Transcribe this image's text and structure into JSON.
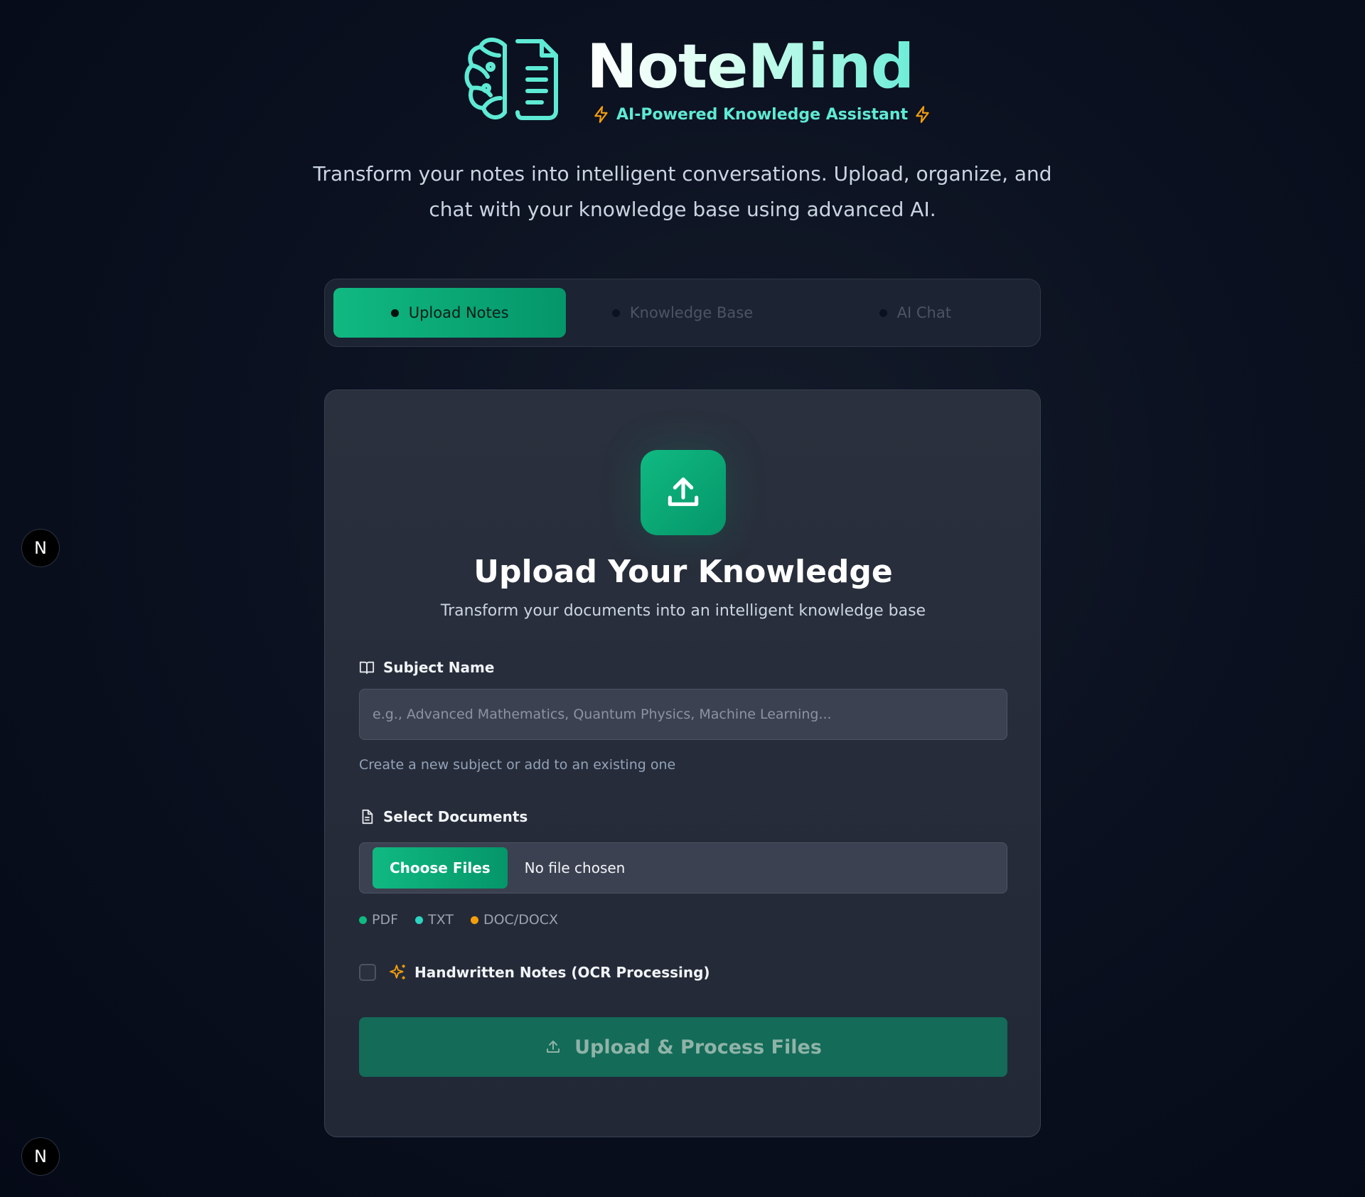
{
  "brand": {
    "name": "NoteMind",
    "tagline": "AI-Powered Knowledge Assistant",
    "logo_icon": "brain-document-icon"
  },
  "intro": {
    "line1": "Transform your notes into intelligent conversations. Upload, organize, and",
    "line2": "chat with your knowledge base using advanced AI."
  },
  "tabs": [
    {
      "label": "Upload Notes",
      "active": true
    },
    {
      "label": "Knowledge Base",
      "active": false
    },
    {
      "label": "AI Chat",
      "active": false
    }
  ],
  "upload": {
    "icon": "upload-icon",
    "title": "Upload Your Knowledge",
    "subtitle": "Transform your documents into an intelligent knowledge base",
    "subject": {
      "label": "Subject Name",
      "icon": "book-open-icon",
      "value": "",
      "placeholder": "e.g., Advanced Mathematics, Quantum Physics, Machine Learning...",
      "help": "Create a new subject or add to an existing one"
    },
    "documents": {
      "label": "Select Documents",
      "icon": "document-icon",
      "choose_button": "Choose Files",
      "status": "No file chosen"
    },
    "formats": [
      {
        "label": "PDF",
        "color": "#10b981"
      },
      {
        "label": "TXT",
        "color": "#2dd4bf"
      },
      {
        "label": "DOC/DOCX",
        "color": "#f59e0b"
      }
    ],
    "ocr": {
      "label": "Handwritten Notes (OCR Processing)",
      "checked": false,
      "icon": "sparkles-icon"
    },
    "submit_label": "Upload & Process Files"
  },
  "badges": {
    "letter": "N"
  },
  "colors": {
    "accent": "#10b981",
    "accent_dark": "#059669",
    "teal": "#5eead4",
    "amber": "#f59e0b"
  }
}
